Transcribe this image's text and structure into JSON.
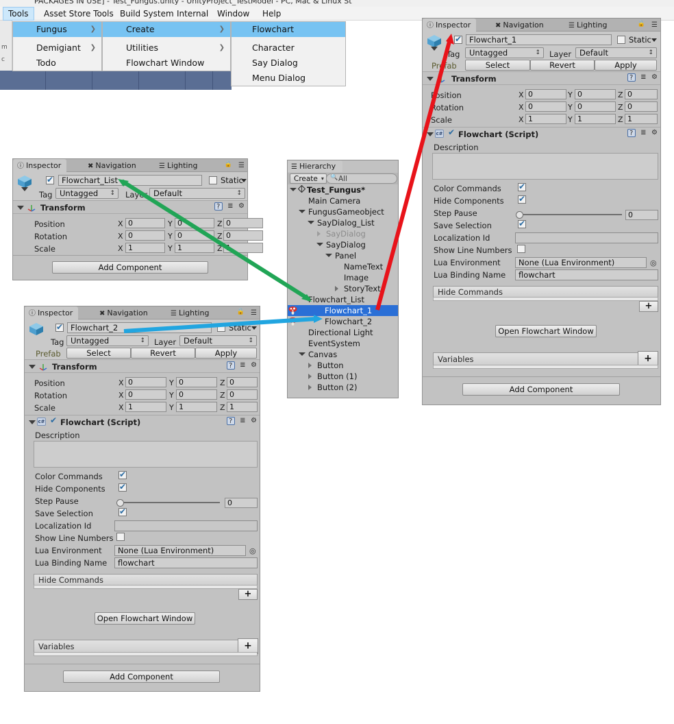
{
  "window": {
    "title_fragment": "PACKAGES IN USE] - Test_Fungus.unity - UnityProject_TestModel - PC, Mac & Linux St"
  },
  "menubar": {
    "items": [
      {
        "label": "Tools",
        "selected": true
      },
      {
        "label": "Asset Store Tools",
        "selected": false
      },
      {
        "label": "Build System",
        "selected": false
      },
      {
        "label": "Internal",
        "selected": false
      },
      {
        "label": "Window",
        "selected": false
      },
      {
        "label": "Help",
        "selected": false
      }
    ]
  },
  "menu_level1": {
    "items": [
      {
        "label": "Fungus",
        "submenu": true,
        "highlighted": true
      },
      {
        "label": "Demigiant",
        "submenu": true,
        "highlighted": false
      },
      {
        "label": "Todo",
        "submenu": false,
        "highlighted": false
      }
    ]
  },
  "menu_level2": {
    "items": [
      {
        "label": "Create",
        "submenu": true,
        "highlighted": true
      },
      {
        "label": "Utilities",
        "submenu": true,
        "highlighted": false
      },
      {
        "label": "Flowchart Window",
        "submenu": false,
        "highlighted": false
      }
    ]
  },
  "menu_level3": {
    "items": [
      {
        "label": "Flowchart",
        "submenu": false,
        "highlighted": true
      },
      {
        "label": "Character",
        "submenu": false,
        "highlighted": false
      },
      {
        "label": "Say Dialog",
        "submenu": false,
        "highlighted": false
      },
      {
        "label": "Menu Dialog",
        "submenu": false,
        "highlighted": false
      }
    ]
  },
  "inspector_tabs": {
    "inspector": "Inspector",
    "navigation": "Navigation",
    "lighting": "Lighting"
  },
  "common": {
    "tag_label": "Tag",
    "tag_value": "Untagged",
    "layer_label": "Layer",
    "layer_value": "Default",
    "static_label": "Static",
    "prefab_label": "Prefab",
    "prefab_select": "Select",
    "prefab_revert": "Revert",
    "prefab_apply": "Apply",
    "transform_title": "Transform",
    "position_label": "Position",
    "rotation_label": "Rotation",
    "scale_label": "Scale",
    "axis_x": "X",
    "axis_y": "Y",
    "axis_z": "Z",
    "position": {
      "x": "0",
      "y": "0",
      "z": "0"
    },
    "rotation": {
      "x": "0",
      "y": "0",
      "z": "0"
    },
    "scale": {
      "x": "1",
      "y": "1",
      "z": "1"
    },
    "add_component": "Add Component",
    "script_title": "Flowchart (Script)",
    "description_label": "Description",
    "description_value": "",
    "color_commands_label": "Color Commands",
    "hide_components_label": "Hide Components",
    "step_pause_label": "Step Pause",
    "step_pause_value": "0",
    "save_selection_label": "Save Selection",
    "localization_id_label": "Localization Id",
    "localization_id_value": "",
    "show_line_numbers_label": "Show Line Numbers",
    "lua_environment_label": "Lua Environment",
    "lua_environment_value": "None (Lua Environment)",
    "lua_binding_name_label": "Lua Binding Name",
    "lua_binding_name_value": "flowchart",
    "hide_commands_label": "Hide Commands",
    "open_flowchart_window": "Open Flowchart Window",
    "variables_label": "Variables",
    "plus_label": "+",
    "color_commands_checked": true,
    "hide_components_checked": true,
    "save_selection_checked": true,
    "show_line_numbers_checked": false
  },
  "inspector_top_left": {
    "object_name": "Flowchart_List",
    "enabled": true,
    "has_prefab_row": false
  },
  "inspector_bottom_left": {
    "object_name": "Flowchart_2",
    "enabled": true,
    "has_prefab_row": true
  },
  "inspector_right": {
    "object_name": "Flowchart_1",
    "enabled": true,
    "has_prefab_row": true
  },
  "hierarchy": {
    "title": "Hierarchy",
    "create_button": "Create",
    "search_placeholder": "All",
    "rows": [
      {
        "label": "Test_Fungus*",
        "depth": 0,
        "twisty": "down",
        "bold": true,
        "icon": "unity-icon",
        "selected": false,
        "dim": false
      },
      {
        "label": "Main Camera",
        "depth": 1,
        "twisty": "none",
        "bold": false,
        "icon": "none",
        "selected": false,
        "dim": false
      },
      {
        "label": "FungusGameobject",
        "depth": 1,
        "twisty": "down",
        "bold": false,
        "icon": "none",
        "selected": false,
        "dim": false
      },
      {
        "label": "SayDialog_List",
        "depth": 2,
        "twisty": "down",
        "bold": false,
        "icon": "none",
        "selected": false,
        "dim": false
      },
      {
        "label": "SayDialog",
        "depth": 3,
        "twisty": "right",
        "bold": false,
        "icon": "none",
        "selected": false,
        "dim": true
      },
      {
        "label": "SayDialog",
        "depth": 3,
        "twisty": "down",
        "bold": false,
        "icon": "none",
        "selected": false,
        "dim": false
      },
      {
        "label": "Panel",
        "depth": 4,
        "twisty": "down",
        "bold": false,
        "icon": "none",
        "selected": false,
        "dim": false
      },
      {
        "label": "NameText",
        "depth": 5,
        "twisty": "none",
        "bold": false,
        "icon": "none",
        "selected": false,
        "dim": false
      },
      {
        "label": "Image",
        "depth": 5,
        "twisty": "none",
        "bold": false,
        "icon": "none",
        "selected": false,
        "dim": false
      },
      {
        "label": "StoryText",
        "depth": 5,
        "twisty": "right",
        "bold": false,
        "icon": "none",
        "selected": false,
        "dim": false
      },
      {
        "label": "Flowchart_List",
        "depth": 1,
        "twisty": "none",
        "bold": false,
        "icon": "none",
        "selected": false,
        "dim": false
      },
      {
        "label": "Flowchart_1",
        "depth": 2,
        "twisty": "none",
        "bold": false,
        "icon": "fungus-icon",
        "selected": true,
        "dim": false
      },
      {
        "label": "Flowchart_2",
        "depth": 2,
        "twisty": "none",
        "bold": false,
        "icon": "fungus-icon",
        "selected": false,
        "dim": false
      },
      {
        "label": "Directional Light",
        "depth": 1,
        "twisty": "none",
        "bold": false,
        "icon": "none",
        "selected": false,
        "dim": false
      },
      {
        "label": "EventSystem",
        "depth": 1,
        "twisty": "none",
        "bold": false,
        "icon": "none",
        "selected": false,
        "dim": false
      },
      {
        "label": "Canvas",
        "depth": 1,
        "twisty": "down",
        "bold": false,
        "icon": "none",
        "selected": false,
        "dim": false
      },
      {
        "label": "Button",
        "depth": 2,
        "twisty": "right",
        "bold": false,
        "icon": "none",
        "selected": false,
        "dim": false
      },
      {
        "label": "Button (1)",
        "depth": 2,
        "twisty": "right",
        "bold": false,
        "icon": "none",
        "selected": false,
        "dim": false
      },
      {
        "label": "Button (2)",
        "depth": 2,
        "twisty": "right",
        "bold": false,
        "icon": "none",
        "selected": false,
        "dim": false
      }
    ]
  },
  "annotations": {
    "green_arrow": {
      "color": "#21a556",
      "from": "hierarchy Flowchart_List",
      "to": "top-left inspector name field"
    },
    "red_arrow": {
      "color": "#e8131a",
      "from": "hierarchy Flowchart_1",
      "to": "right inspector enabled checkbox"
    },
    "blue_arrow": {
      "color": "#21a5e0",
      "from": "bottom-left inspector name field",
      "to": "hierarchy Flowchart_2"
    }
  }
}
